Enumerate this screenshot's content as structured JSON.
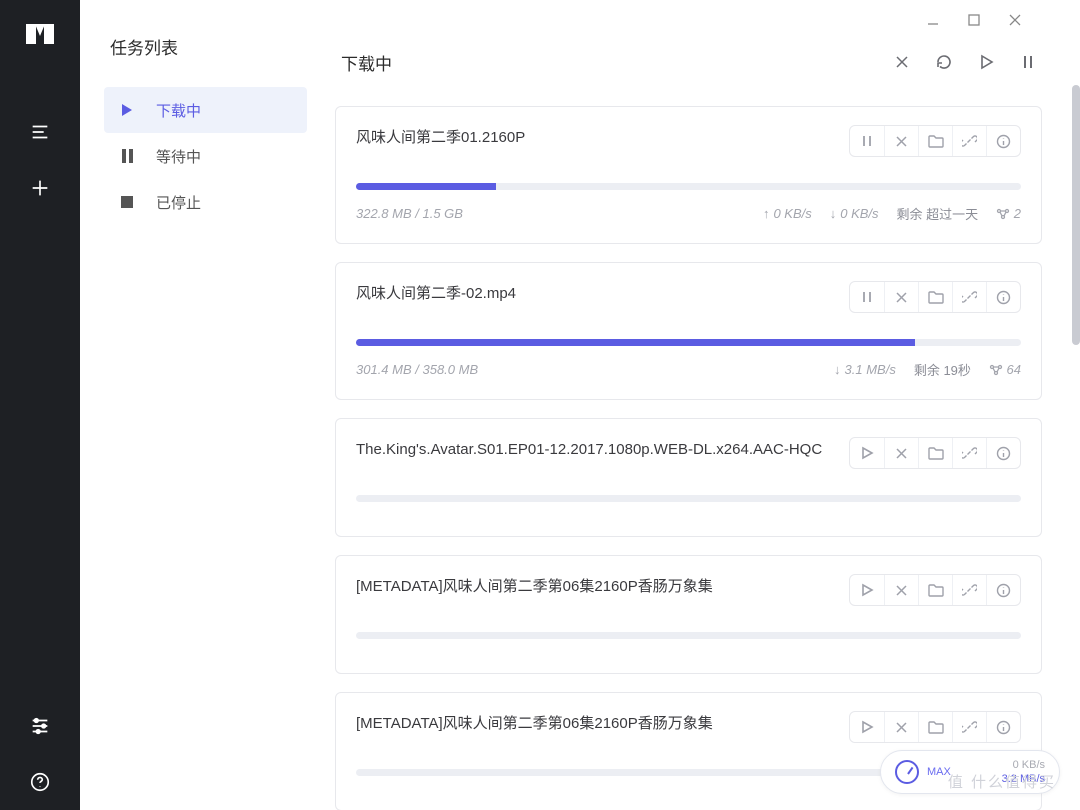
{
  "sidebar": {
    "title": "任务列表",
    "items": [
      {
        "label": "下载中"
      },
      {
        "label": "等待中"
      },
      {
        "label": "已停止"
      }
    ]
  },
  "header": {
    "title": "下载中"
  },
  "tasks": [
    {
      "name": "风味人间第二季01.2160P",
      "progress": 21,
      "size": "322.8 MB / 1.5 GB",
      "up": "0 KB/s",
      "down": "0 KB/s",
      "remain": "剩余 超过一天",
      "peers": "2",
      "action_icon": "pause"
    },
    {
      "name": "风味人间第二季-02.mp4",
      "progress": 84,
      "size": "301.4 MB / 358.0 MB",
      "up": "",
      "down": "3.1 MB/s",
      "remain": "剩余 19秒",
      "peers": "64",
      "action_icon": "pause"
    },
    {
      "name": "The.King's.Avatar.S01.EP01-12.2017.1080p.WEB-DL.x264.AAC-HQC",
      "progress": 0,
      "size": "",
      "up": "",
      "down": "",
      "remain": "",
      "peers": "",
      "action_icon": "play"
    },
    {
      "name": "[METADATA]风味人间第二季第06集2160P香肠万象集",
      "progress": 0,
      "size": "",
      "up": "",
      "down": "",
      "remain": "",
      "peers": "",
      "action_icon": "play"
    },
    {
      "name": "[METADATA]风味人间第二季第06集2160P香肠万象集",
      "progress": 0,
      "size": "",
      "up": "",
      "down": "",
      "remain": "",
      "peers": "",
      "action_icon": "play"
    }
  ],
  "speed": {
    "label": "MAX",
    "up": "0 KB/s",
    "down": "3.2 MB/s"
  },
  "watermark": "值 什么值得买"
}
